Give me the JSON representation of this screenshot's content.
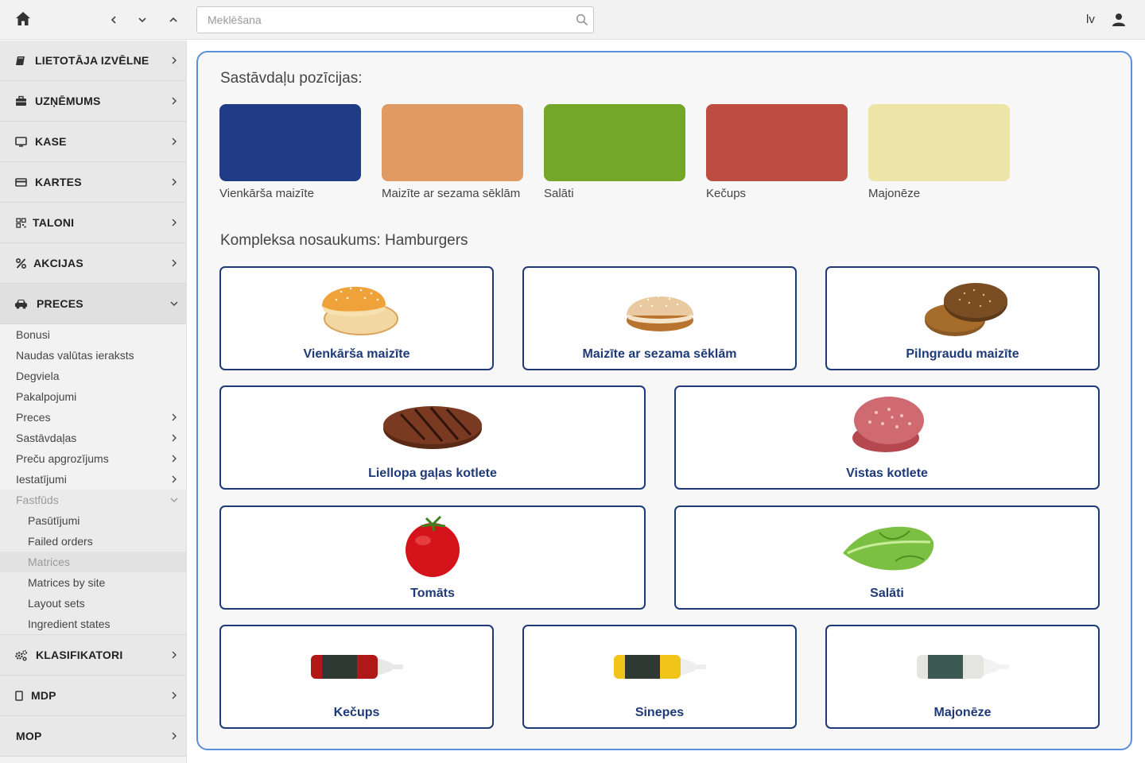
{
  "topbar": {
    "search_placeholder": "Meklēšana",
    "language": "lv"
  },
  "sidebar": {
    "items": [
      {
        "label": "LIETOTĀJA IZVĒLNE",
        "icon": "book-icon"
      },
      {
        "label": "UZŅĒMUMS",
        "icon": "briefcase-icon"
      },
      {
        "label": "KASE",
        "icon": "monitor-icon"
      },
      {
        "label": "KARTES",
        "icon": "credit-card-icon"
      },
      {
        "label": "TALONI",
        "icon": "qr-code-icon"
      },
      {
        "label": "AKCIJAS",
        "icon": "percent-icon"
      },
      {
        "label": "PRECES",
        "icon": "car-icon"
      }
    ],
    "preces_sub": [
      {
        "label": "Bonusi"
      },
      {
        "label": "Naudas valūtas ieraksts"
      },
      {
        "label": "Degviela"
      },
      {
        "label": "Pakalpojumi"
      },
      {
        "label": "Preces"
      },
      {
        "label": "Sastāvdaļas"
      },
      {
        "label": "Preču apgrozījums"
      },
      {
        "label": "Iestatījumi"
      },
      {
        "label": "Fastfūds"
      }
    ],
    "fastfuds_sub": [
      {
        "label": "Pasūtījumi"
      },
      {
        "label": "Failed orders"
      },
      {
        "label": "Matrices"
      },
      {
        "label": "Matrices by site"
      },
      {
        "label": "Layout sets"
      },
      {
        "label": "Ingredient states"
      }
    ],
    "bottom_items": [
      {
        "label": "KLASIFIKATORI",
        "icon": "cogs-icon"
      },
      {
        "label": "MDP",
        "icon": "mobile-icon"
      },
      {
        "label": "MOP",
        "icon": ""
      }
    ]
  },
  "main": {
    "positions_title": "Sastāvdaļu pozīcijas:",
    "positions": [
      {
        "label": "Vienkārša maizīte",
        "color": "#213c86"
      },
      {
        "label": "Maizīte ar sezama sēklām",
        "color": "#e19a62"
      },
      {
        "label": "Salāti",
        "color": "#74a628"
      },
      {
        "label": "Kečups",
        "color": "#bd4c41"
      },
      {
        "label": "Majonēze",
        "color": "#ede5a8"
      }
    ],
    "complex_title": "Kompleksa nosaukums: Hamburgers",
    "ingredients": [
      {
        "label": "Vienkārša maizīte",
        "icon": "plain-bun-icon"
      },
      {
        "label": "Maizīte ar sezama sēklām",
        "icon": "sesame-bun-icon"
      },
      {
        "label": "Pilngraudu maizīte",
        "icon": "wholegrain-bun-icon"
      },
      {
        "label": "Liellopa gaļas kotlete",
        "icon": "beef-patty-icon"
      },
      {
        "label": "Vistas kotlete",
        "icon": "chicken-patty-icon"
      },
      {
        "label": "Tomāts",
        "icon": "tomato-icon"
      },
      {
        "label": "Salāti",
        "icon": "lettuce-icon"
      },
      {
        "label": "Kečups",
        "icon": "ketchup-bottle-icon"
      },
      {
        "label": "Sinepes",
        "icon": "mustard-bottle-icon"
      },
      {
        "label": "Majonēze",
        "icon": "mayonnaise-bottle-icon"
      }
    ]
  }
}
